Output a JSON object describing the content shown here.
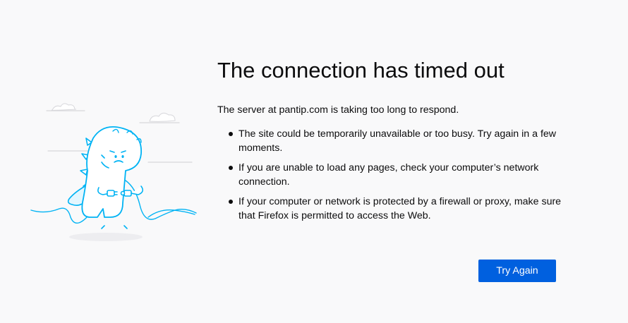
{
  "error": {
    "title": "The connection has timed out",
    "description": "The server at pantip.com is taking too long to respond.",
    "reasons": [
      "The site could be temporarily unavailable or too busy. Try again in a few moments.",
      "If you are unable to load any pages, check your computer’s network connection.",
      "If your computer or network is protected by a firewall or proxy, make sure that Firefox is permitted to access the Web."
    ],
    "try_again_label": "Try Again",
    "illustration_icon": "unplugged-dinosaur-icon"
  },
  "colors": {
    "background": "#f9f9fa",
    "text": "#0c0c0d",
    "button": "#0060df",
    "illustration": "#00b3f4"
  }
}
